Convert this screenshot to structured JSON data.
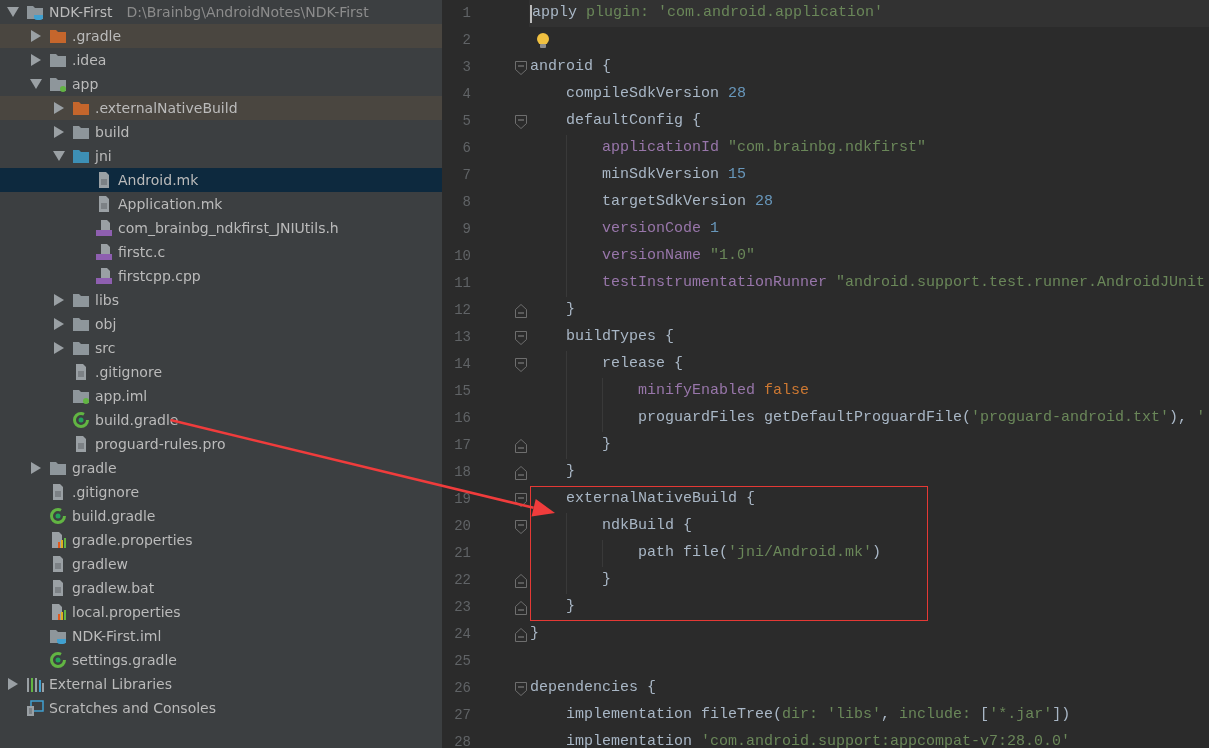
{
  "project_tree": {
    "items": [
      {
        "name": "NDK-First",
        "path": "D:\\Brainbg\\AndroidNotes\\NDK-First",
        "kind": "project",
        "expanded": true,
        "selected": false,
        "excluded": false,
        "children": [
          {
            "name": ".gradle",
            "kind": "folder",
            "expanded": false,
            "selected": false,
            "excluded": true
          },
          {
            "name": ".idea",
            "kind": "folder",
            "expanded": false,
            "selected": false,
            "excluded": false
          },
          {
            "name": "app",
            "kind": "module",
            "expanded": true,
            "selected": false,
            "excluded": false,
            "children": [
              {
                "name": ".externalNativeBuild",
                "kind": "folder",
                "expanded": false,
                "selected": false,
                "excluded": true
              },
              {
                "name": "build",
                "kind": "folder",
                "expanded": false,
                "selected": false,
                "excluded": false
              },
              {
                "name": "jni",
                "kind": "source",
                "expanded": true,
                "selected": false,
                "excluded": false,
                "children": [
                  {
                    "name": "Android.mk",
                    "kind": "text",
                    "selected": true,
                    "excluded": false
                  },
                  {
                    "name": "Application.mk",
                    "kind": "text",
                    "selected": false,
                    "excluded": false
                  },
                  {
                    "name": "com_brainbg_ndkfirst_JNIUtils.h",
                    "kind": "cpp",
                    "selected": false,
                    "excluded": false
                  },
                  {
                    "name": "firstc.c",
                    "kind": "cpp",
                    "selected": false,
                    "excluded": false
                  },
                  {
                    "name": "firstcpp.cpp",
                    "kind": "cpp",
                    "selected": false,
                    "excluded": false
                  }
                ]
              },
              {
                "name": "libs",
                "kind": "folder",
                "expanded": false,
                "selected": false,
                "excluded": false
              },
              {
                "name": "obj",
                "kind": "folder",
                "expanded": false,
                "selected": false,
                "excluded": false
              },
              {
                "name": "src",
                "kind": "folder",
                "expanded": false,
                "selected": false,
                "excluded": false
              },
              {
                "name": ".gitignore",
                "kind": "text",
                "selected": false,
                "excluded": false
              },
              {
                "name": "app.iml",
                "kind": "module",
                "selected": false,
                "excluded": false
              },
              {
                "name": "build.gradle",
                "kind": "gradle",
                "selected": false,
                "excluded": false,
                "annotated": true
              },
              {
                "name": "proguard-rules.pro",
                "kind": "text",
                "selected": false,
                "excluded": false
              }
            ]
          },
          {
            "name": "gradle",
            "kind": "folder",
            "expanded": false,
            "selected": false,
            "excluded": false
          },
          {
            "name": ".gitignore",
            "kind": "text",
            "selected": false,
            "excluded": false
          },
          {
            "name": "build.gradle",
            "kind": "gradle",
            "selected": false,
            "excluded": false
          },
          {
            "name": "gradle.properties",
            "kind": "properties",
            "selected": false,
            "excluded": false
          },
          {
            "name": "gradlew",
            "kind": "text",
            "selected": false,
            "excluded": false
          },
          {
            "name": "gradlew.bat",
            "kind": "text",
            "selected": false,
            "excluded": false
          },
          {
            "name": "local.properties",
            "kind": "properties",
            "selected": false,
            "excluded": false
          },
          {
            "name": "NDK-First.iml",
            "kind": "project",
            "selected": false,
            "excluded": false
          },
          {
            "name": "settings.gradle",
            "kind": "gradle",
            "selected": false,
            "excluded": false
          }
        ]
      },
      {
        "name": "External Libraries",
        "kind": "libraries",
        "expanded": false,
        "selected": false,
        "excluded": false
      },
      {
        "name": "Scratches and Consoles",
        "kind": "scratches",
        "selected": false,
        "excluded": false
      }
    ]
  },
  "editor": {
    "lines": [
      {
        "number": "1",
        "kind": "code",
        "current": true,
        "boxed": false,
        "fold_start": false,
        "fold_end": false,
        "segments": [
          {
            "kind": "plain",
            "text": "apply"
          },
          {
            "kind": "named",
            "text": " plugin: "
          },
          {
            "kind": "string",
            "text": "'com.android.application'"
          }
        ]
      },
      {
        "number": "2",
        "kind": "bulb",
        "current": false,
        "boxed": false,
        "fold_start": false,
        "fold_end": false
      },
      {
        "number": "3",
        "kind": "code",
        "current": false,
        "boxed": false,
        "fold_start": true,
        "fold_end": false,
        "segments": [
          {
            "kind": "plain",
            "text": "android {"
          }
        ]
      },
      {
        "number": "4",
        "kind": "code",
        "current": false,
        "boxed": false,
        "fold_start": false,
        "fold_end": false,
        "segments": [
          {
            "kind": "plain",
            "text": "    compileSdkVersion "
          },
          {
            "kind": "number",
            "text": "28"
          }
        ]
      },
      {
        "number": "5",
        "kind": "code",
        "current": false,
        "boxed": false,
        "fold_start": true,
        "fold_end": false,
        "segments": [
          {
            "kind": "plain",
            "text": "    defaultConfig {"
          }
        ]
      },
      {
        "number": "6",
        "kind": "code",
        "current": false,
        "boxed": false,
        "fold_start": false,
        "fold_end": false,
        "segments": [
          {
            "kind": "property",
            "text": "        applicationId "
          },
          {
            "kind": "string",
            "text": "\"com.brainbg.ndkfirst\""
          }
        ]
      },
      {
        "number": "7",
        "kind": "code",
        "current": false,
        "boxed": false,
        "fold_start": false,
        "fold_end": false,
        "segments": [
          {
            "kind": "plain",
            "text": "        minSdkVersion "
          },
          {
            "kind": "number",
            "text": "15"
          }
        ]
      },
      {
        "number": "8",
        "kind": "code",
        "current": false,
        "boxed": false,
        "fold_start": false,
        "fold_end": false,
        "segments": [
          {
            "kind": "plain",
            "text": "        targetSdkVersion "
          },
          {
            "kind": "number",
            "text": "28"
          }
        ]
      },
      {
        "number": "9",
        "kind": "code",
        "current": false,
        "boxed": false,
        "fold_start": false,
        "fold_end": false,
        "segments": [
          {
            "kind": "property",
            "text": "        versionCode "
          },
          {
            "kind": "number",
            "text": "1"
          }
        ]
      },
      {
        "number": "10",
        "kind": "code",
        "current": false,
        "boxed": false,
        "fold_start": false,
        "fold_end": false,
        "segments": [
          {
            "kind": "property",
            "text": "        versionName "
          },
          {
            "kind": "string",
            "text": "\"1.0\""
          }
        ]
      },
      {
        "number": "11",
        "kind": "code",
        "current": false,
        "boxed": false,
        "fold_start": false,
        "fold_end": false,
        "segments": [
          {
            "kind": "property",
            "text": "        testInstrumentationRunner "
          },
          {
            "kind": "string",
            "text": "\"android.support.test.runner.AndroidJUnit"
          }
        ]
      },
      {
        "number": "12",
        "kind": "code",
        "current": false,
        "boxed": false,
        "fold_start": false,
        "fold_end": true,
        "segments": [
          {
            "kind": "plain",
            "text": "    }"
          }
        ]
      },
      {
        "number": "13",
        "kind": "code",
        "current": false,
        "boxed": false,
        "fold_start": true,
        "fold_end": false,
        "segments": [
          {
            "kind": "plain",
            "text": "    buildTypes {"
          }
        ]
      },
      {
        "number": "14",
        "kind": "code",
        "current": false,
        "boxed": false,
        "fold_start": true,
        "fold_end": false,
        "segments": [
          {
            "kind": "plain",
            "text": "        release {"
          }
        ]
      },
      {
        "number": "15",
        "kind": "code",
        "current": false,
        "boxed": false,
        "fold_start": false,
        "fold_end": false,
        "segments": [
          {
            "kind": "property",
            "text": "            minifyEnabled "
          },
          {
            "kind": "keyword",
            "text": "false"
          }
        ]
      },
      {
        "number": "16",
        "kind": "code",
        "current": false,
        "boxed": false,
        "fold_start": false,
        "fold_end": false,
        "segments": [
          {
            "kind": "plain",
            "text": "            proguardFiles getDefaultProguardFile("
          },
          {
            "kind": "string",
            "text": "'proguard-android.txt'"
          },
          {
            "kind": "plain",
            "text": "), "
          },
          {
            "kind": "string",
            "text": "'"
          }
        ]
      },
      {
        "number": "17",
        "kind": "code",
        "current": false,
        "boxed": false,
        "fold_start": false,
        "fold_end": true,
        "segments": [
          {
            "kind": "plain",
            "text": "        }"
          }
        ]
      },
      {
        "number": "18",
        "kind": "code",
        "current": false,
        "boxed": false,
        "fold_start": false,
        "fold_end": true,
        "segments": [
          {
            "kind": "plain",
            "text": "    }"
          }
        ]
      },
      {
        "number": "19",
        "kind": "code",
        "current": false,
        "boxed": true,
        "fold_start": true,
        "fold_end": false,
        "segments": [
          {
            "kind": "plain",
            "text": "    externalNativeBuild {"
          }
        ]
      },
      {
        "number": "20",
        "kind": "code",
        "current": false,
        "boxed": true,
        "fold_start": true,
        "fold_end": false,
        "segments": [
          {
            "kind": "plain",
            "text": "        ndkBuild {"
          }
        ]
      },
      {
        "number": "21",
        "kind": "code",
        "current": false,
        "boxed": true,
        "fold_start": false,
        "fold_end": false,
        "segments": [
          {
            "kind": "plain",
            "text": "            path file("
          },
          {
            "kind": "string",
            "text": "'jni/Android.mk'"
          },
          {
            "kind": "plain",
            "text": ")"
          }
        ]
      },
      {
        "number": "22",
        "kind": "code",
        "current": false,
        "boxed": true,
        "fold_start": false,
        "fold_end": true,
        "segments": [
          {
            "kind": "plain",
            "text": "        }"
          }
        ]
      },
      {
        "number": "23",
        "kind": "code",
        "current": false,
        "boxed": true,
        "fold_start": false,
        "fold_end": true,
        "segments": [
          {
            "kind": "plain",
            "text": "    }"
          }
        ]
      },
      {
        "number": "24",
        "kind": "code",
        "current": false,
        "boxed": false,
        "fold_start": false,
        "fold_end": true,
        "segments": [
          {
            "kind": "plain",
            "text": "}"
          }
        ]
      },
      {
        "number": "25",
        "kind": "code",
        "current": false,
        "boxed": false,
        "fold_start": false,
        "fold_end": false
      },
      {
        "number": "26",
        "kind": "code",
        "current": false,
        "boxed": false,
        "fold_start": true,
        "fold_end": false,
        "segments": [
          {
            "kind": "plain",
            "text": "dependencies {"
          }
        ]
      },
      {
        "number": "27",
        "kind": "code",
        "current": false,
        "boxed": false,
        "fold_start": false,
        "fold_end": false,
        "segments": [
          {
            "kind": "plain",
            "text": "    implementation fileTree("
          },
          {
            "kind": "named",
            "text": "dir: "
          },
          {
            "kind": "string",
            "text": "'libs'"
          },
          {
            "kind": "plain",
            "text": ", "
          },
          {
            "kind": "named",
            "text": "include: "
          },
          {
            "kind": "plain",
            "text": "["
          },
          {
            "kind": "string",
            "text": "'*.jar'"
          },
          {
            "kind": "plain",
            "text": "])"
          }
        ]
      },
      {
        "number": "28",
        "kind": "code",
        "current": false,
        "boxed": false,
        "fold_start": false,
        "fold_end": false,
        "segments": [
          {
            "kind": "plain",
            "text": "    implementation "
          },
          {
            "kind": "string",
            "text": "'com.android.support:appcompat-v7:28.0.0'"
          }
        ]
      }
    ]
  }
}
